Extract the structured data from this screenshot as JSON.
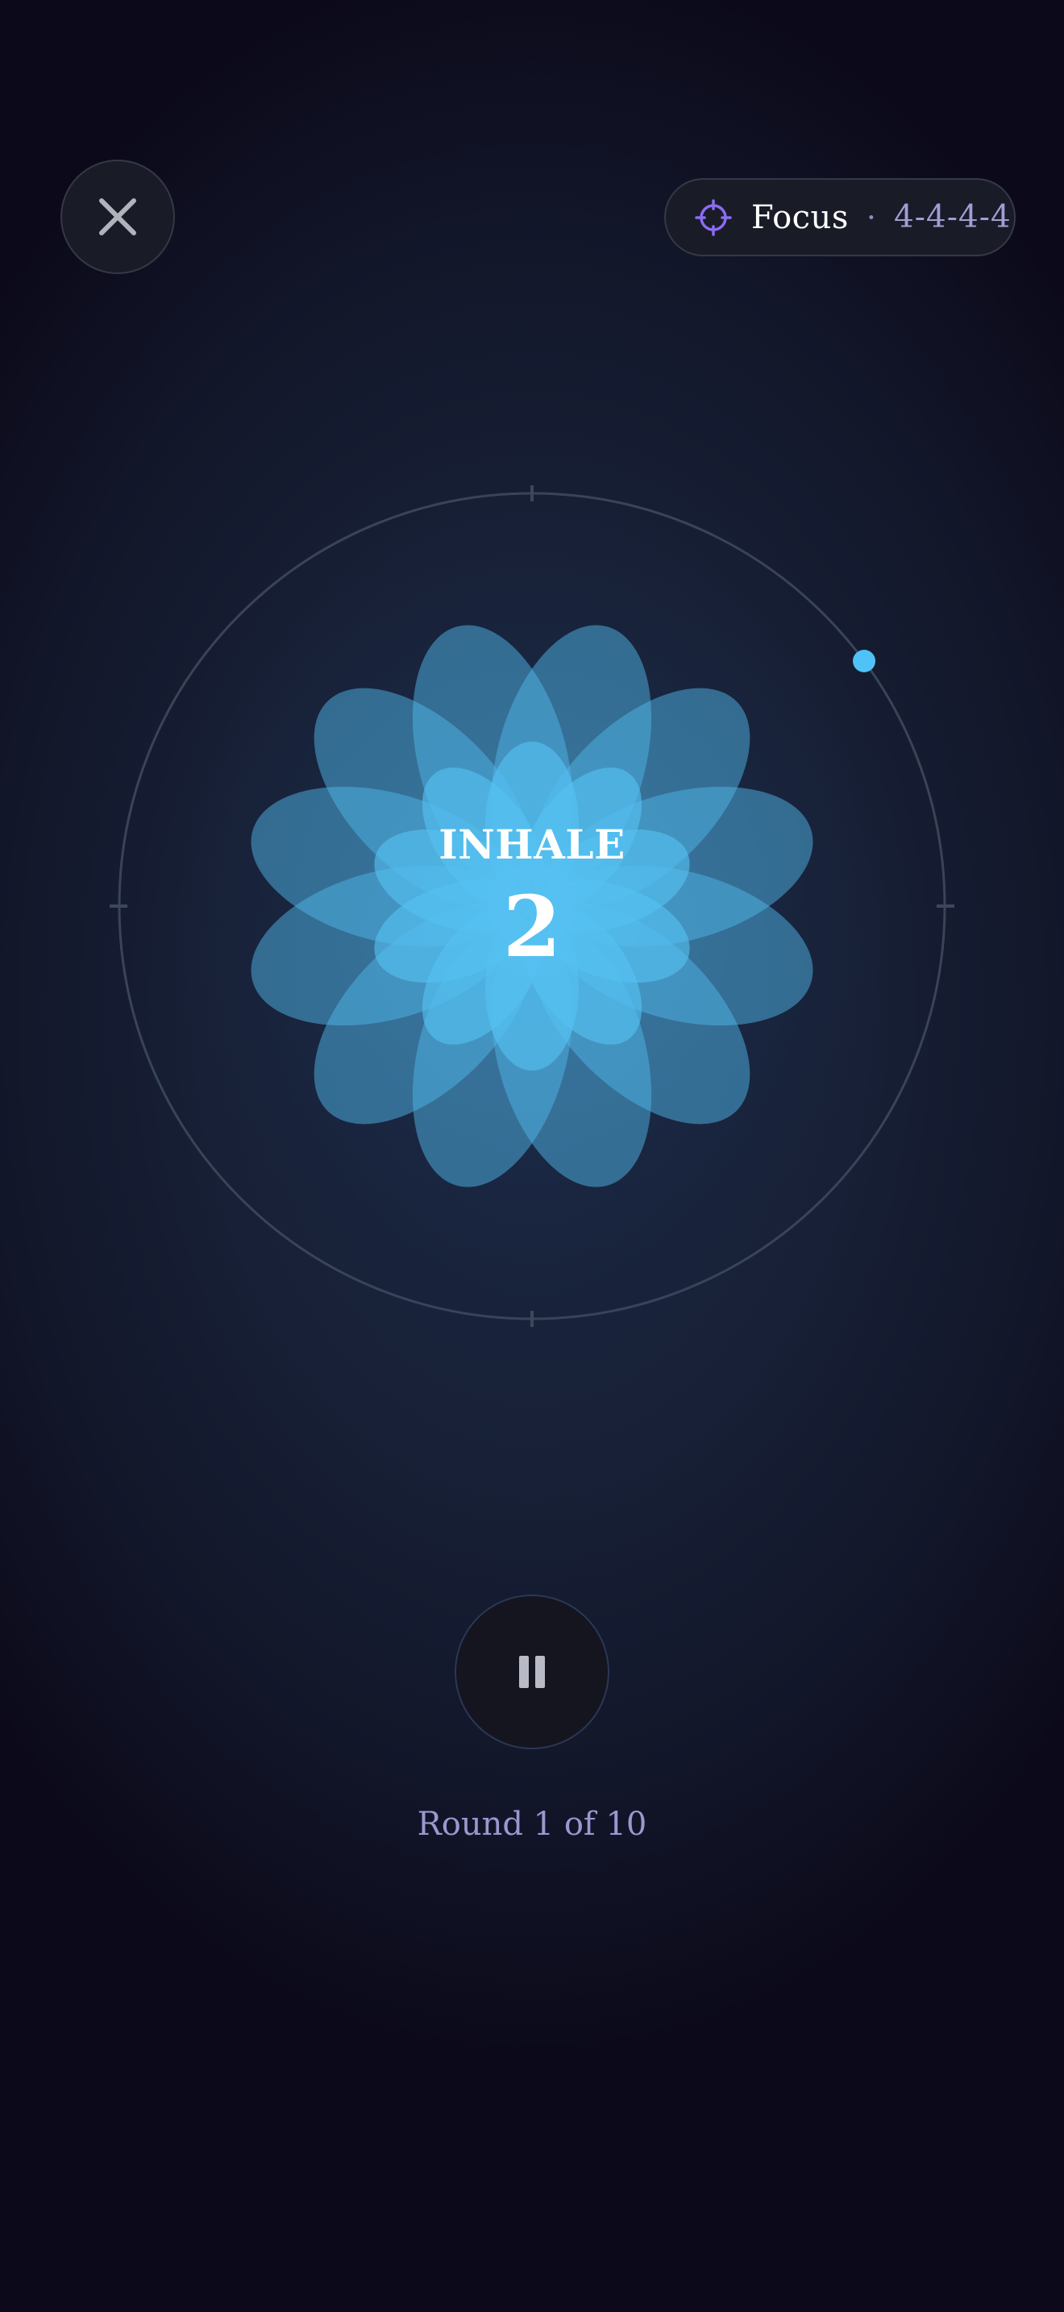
{
  "header": {
    "close_icon": "close-icon",
    "mode_icon": "crosshair-target-icon",
    "mode_name": "Focus",
    "separator": "·",
    "pattern": "4-4-4-4"
  },
  "breathing": {
    "phase": "INHALE",
    "count": "2",
    "accent_color": "#4fc3f7",
    "progress_icon": "progress-dot"
  },
  "controls": {
    "pause_icon": "pause-icon",
    "round_text": "Round 1 of 10"
  },
  "colors": {
    "background": "#121629",
    "mode_icon": "#8a6cf0",
    "round_text": "#9b97cf"
  }
}
